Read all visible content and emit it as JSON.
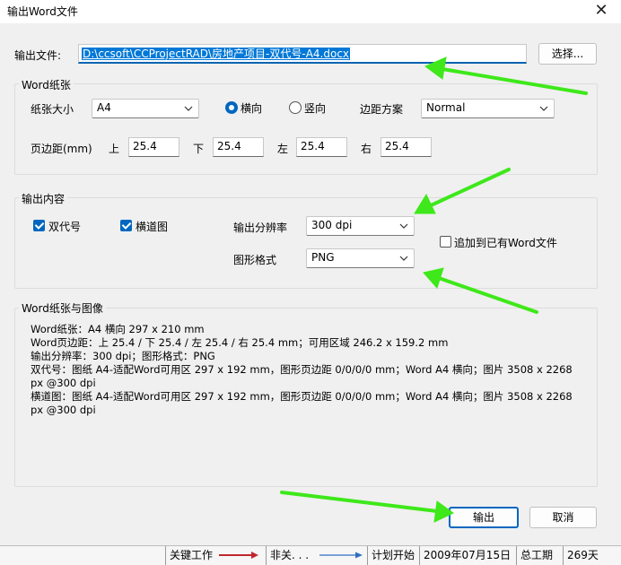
{
  "window": {
    "title": "输出Word文件",
    "close_glyph": "✕"
  },
  "output_file": {
    "label": "输出文件:",
    "path": "D:\\ccsoft\\CCProjectRAD\\房地产项目-双代号-A4.docx",
    "browse_label": "选择..."
  },
  "paper_group": {
    "title": "Word纸张",
    "size_label": "纸张大小",
    "size_value": "A4",
    "orientation": {
      "landscape_label": "横向",
      "portrait_label": "竖向",
      "selected": "landscape"
    },
    "margin_scheme_label": "边距方案",
    "margin_scheme_value": "Normal",
    "margins_label": "页边距(mm)",
    "top_label": "上",
    "top_value": "25.4",
    "bottom_label": "下",
    "bottom_value": "25.4",
    "left_label": "左",
    "left_value": "25.4",
    "right_label": "右",
    "right_value": "25.4"
  },
  "content_group": {
    "title": "输出内容",
    "dual_code_label": "双代号",
    "dual_code_checked": true,
    "lane_label": "横道图",
    "lane_checked": true,
    "resolution_label": "输出分辨率",
    "resolution_value": "300 dpi",
    "format_label": "图形格式",
    "format_value": "PNG",
    "append_label": "追加到已有Word文件",
    "append_checked": false
  },
  "info_group": {
    "title": "Word纸张与图像",
    "lines": [
      "Word纸张：A4 横向 297 x 210 mm",
      "Word页边距：上 25.4 / 下 25.4 / 左 25.4 / 右 25.4 mm；可用区域 246.2 x 159.2 mm",
      "输出分辨率：300 dpi；图形格式：PNG",
      "双代号：图纸 A4-适配Word可用区 297 x 192 mm，图形页边距 0/0/0/0 mm；Word A4 横向；图片 3508 x 2268",
      "px @300 dpi",
      "横道图：图纸 A4-适配Word可用区 297 x 192 mm，图形页边距 0/0/0/0 mm；Word A4 横向；图片 3508 x 2268",
      "px @300 dpi"
    ]
  },
  "buttons": {
    "ok_label": "输出",
    "cancel_label": "取消"
  },
  "statusbar": {
    "critical_label": "关键工作",
    "noncritical_label": "非关. . .",
    "planned_start_label": "计划开始",
    "planned_start_value": "2009年07月15日",
    "duration_label": "总工期",
    "duration_value": "269天"
  },
  "colors": {
    "accent": "#0067c0",
    "selection": "#0078d7",
    "annotation_arrow": "#3ee81a",
    "critical_arrow": "#c0282d",
    "noncritical_arrow": "#2f6fc2"
  }
}
